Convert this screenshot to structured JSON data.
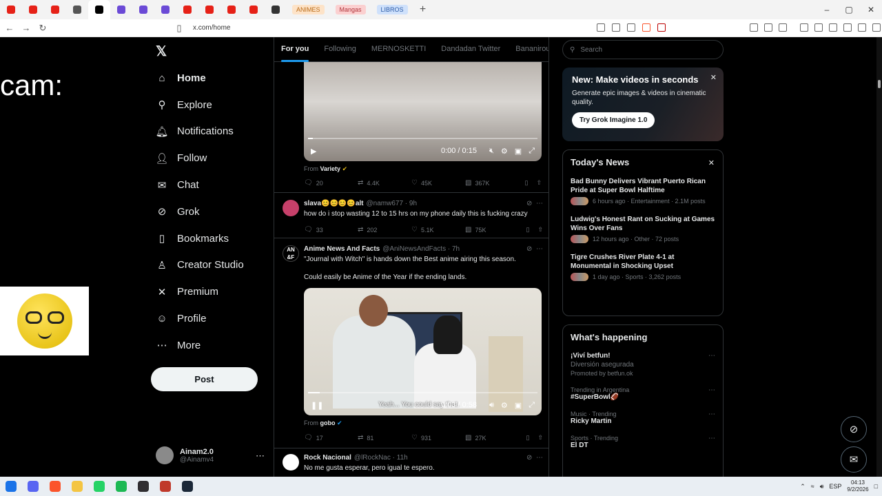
{
  "browser": {
    "tabs": [
      {
        "icon": "youtube-icon",
        "color": "#e62117"
      },
      {
        "icon": "youtube-icon",
        "color": "#e62117"
      },
      {
        "icon": "youtube-icon",
        "color": "#e62117"
      },
      {
        "icon": "muted-audio-icon",
        "color": "#555555"
      },
      {
        "icon": "x-icon",
        "color": "#000000"
      },
      {
        "icon": "feather-icon",
        "color": "#6b4ad6"
      },
      {
        "icon": "feather-icon",
        "color": "#6b4ad6"
      },
      {
        "icon": "feather-icon",
        "color": "#6b4ad6"
      },
      {
        "icon": "youtube-icon",
        "color": "#e62117"
      },
      {
        "icon": "youtube-icon",
        "color": "#e62117"
      },
      {
        "icon": "youtube-icon",
        "color": "#e62117"
      },
      {
        "icon": "youtube-icon",
        "color": "#e62117"
      },
      {
        "icon": "github-icon",
        "color": "#333333"
      }
    ],
    "group_tabs": [
      {
        "label": "ANIMES",
        "bg": "#fde3c8",
        "fg": "#b96a16"
      },
      {
        "label": "Mangas",
        "bg": "#fbd0d0",
        "fg": "#b0343a"
      },
      {
        "label": "LIBROS",
        "bg": "#cfe1fb",
        "fg": "#2c5ca8"
      }
    ],
    "url": "x.com/home"
  },
  "overlay": {
    "cam_label": "cam:"
  },
  "sidebar": {
    "items": [
      {
        "label": "Home",
        "icon": "⌂",
        "name": "home-icon"
      },
      {
        "label": "Explore",
        "icon": "⚲",
        "name": "search-icon"
      },
      {
        "label": "Notifications",
        "icon": "🔔︎",
        "name": "bell-icon"
      },
      {
        "label": "Follow",
        "icon": "👤︎",
        "name": "follow-icon"
      },
      {
        "label": "Chat",
        "icon": "✉",
        "name": "mail-icon"
      },
      {
        "label": "Grok",
        "icon": "⊘",
        "name": "grok-icon"
      },
      {
        "label": "Bookmarks",
        "icon": "▯",
        "name": "bookmark-icon"
      },
      {
        "label": "Creator Studio",
        "icon": "♙",
        "name": "creator-icon"
      },
      {
        "label": "Premium",
        "icon": "✕",
        "name": "x-logo-icon"
      },
      {
        "label": "Profile",
        "icon": "☺",
        "name": "profile-icon"
      },
      {
        "label": "More",
        "icon": "⋯",
        "name": "more-icon"
      }
    ],
    "post_label": "Post",
    "account": {
      "name": "Ainam2.0",
      "handle": "@Ainamv4"
    }
  },
  "feed": {
    "tabs": [
      "For you",
      "Following",
      "MERNOSKETTI",
      "Dandadan Twitter",
      "Bananirou"
    ],
    "post1": {
      "video_time": "0:00 / 0:15",
      "from_label": "From",
      "from": "Variety",
      "replies": "20",
      "reposts": "4.4K",
      "likes": "45K",
      "views": "367K"
    },
    "post2": {
      "name": "slava😊😊😊😊alt",
      "handle": "@namw677",
      "age": "· 9h",
      "text": "how do i stop wasting 12 to 15 hrs on my phone daily this is fucking crazy",
      "replies": "33",
      "reposts": "202",
      "likes": "5.1K",
      "views": "75K"
    },
    "post3": {
      "name": "Anime News And Facts",
      "handle": "@AniNewsAndFacts",
      "age": "· 7h",
      "text1": "\"Journal with Witch\" is hands down the Best anime airing this season.",
      "text2": "Could easily be Anime of the Year if the ending lands.",
      "subtitle": "Yeah... You could say that.",
      "video_time": "0:03 / 0:58",
      "from_label": "From",
      "from": "gobo",
      "replies": "17",
      "reposts": "81",
      "likes": "931",
      "views": "27K"
    },
    "post4": {
      "name": "Rock Nacional",
      "handle": "@lRockNac",
      "age": "· 11h",
      "text": "No me gusta esperar, pero igual te espero."
    }
  },
  "right": {
    "search_placeholder": "Search",
    "promo": {
      "title": "New: Make videos in seconds",
      "desc": "Generate epic images & videos in cinematic quality.",
      "button": "Try Grok Imagine 1.0"
    },
    "news_title": "Today's News",
    "news": [
      {
        "title": "Bad Bunny Delivers Vibrant Puerto Rican Pride at Super Bowl Halftime",
        "meta": "6 hours ago · Entertainment · 2.1M posts"
      },
      {
        "title": "Ludwig's Honest Rant on Sucking at Games Wins Over Fans",
        "meta": "12 hours ago · Other · 72 posts"
      },
      {
        "title": "Tigre Crushes River Plate 4-1 at Monumental in Shocking Upset",
        "meta": "1 day ago · Sports · 3,262 posts"
      }
    ],
    "happening_title": "What's happening",
    "trends": [
      {
        "context": "",
        "title": "¡Viví betfun!",
        "sub": "Diversión asegurada",
        "promo": "Promoted by betfun.ok"
      },
      {
        "context": "Trending in Argentina",
        "title": "#SuperBowl🏈",
        "sub": "",
        "promo": ""
      },
      {
        "context": "Music · Trending",
        "title": "Ricky Martin",
        "sub": "",
        "promo": ""
      },
      {
        "context": "Sports · Trending",
        "title": "El DT",
        "sub": "",
        "promo": ""
      }
    ]
  },
  "taskbar": {
    "apps": [
      {
        "name": "windows-start-icon",
        "color": "#1a73e8"
      },
      {
        "name": "discord-icon",
        "color": "#5865f2"
      },
      {
        "name": "brave-icon",
        "color": "#fb542b"
      },
      {
        "name": "file-explorer-icon",
        "color": "#f4c542"
      },
      {
        "name": "whatsapp-icon",
        "color": "#25d366"
      },
      {
        "name": "spotify-icon",
        "color": "#1db954"
      },
      {
        "name": "obs-icon",
        "color": "#302e31"
      },
      {
        "name": "app-icon",
        "color": "#c0392b"
      },
      {
        "name": "steam-icon",
        "color": "#1b2838"
      }
    ],
    "lang": "ESP",
    "time": "04:13",
    "date": "9/2/2026"
  }
}
